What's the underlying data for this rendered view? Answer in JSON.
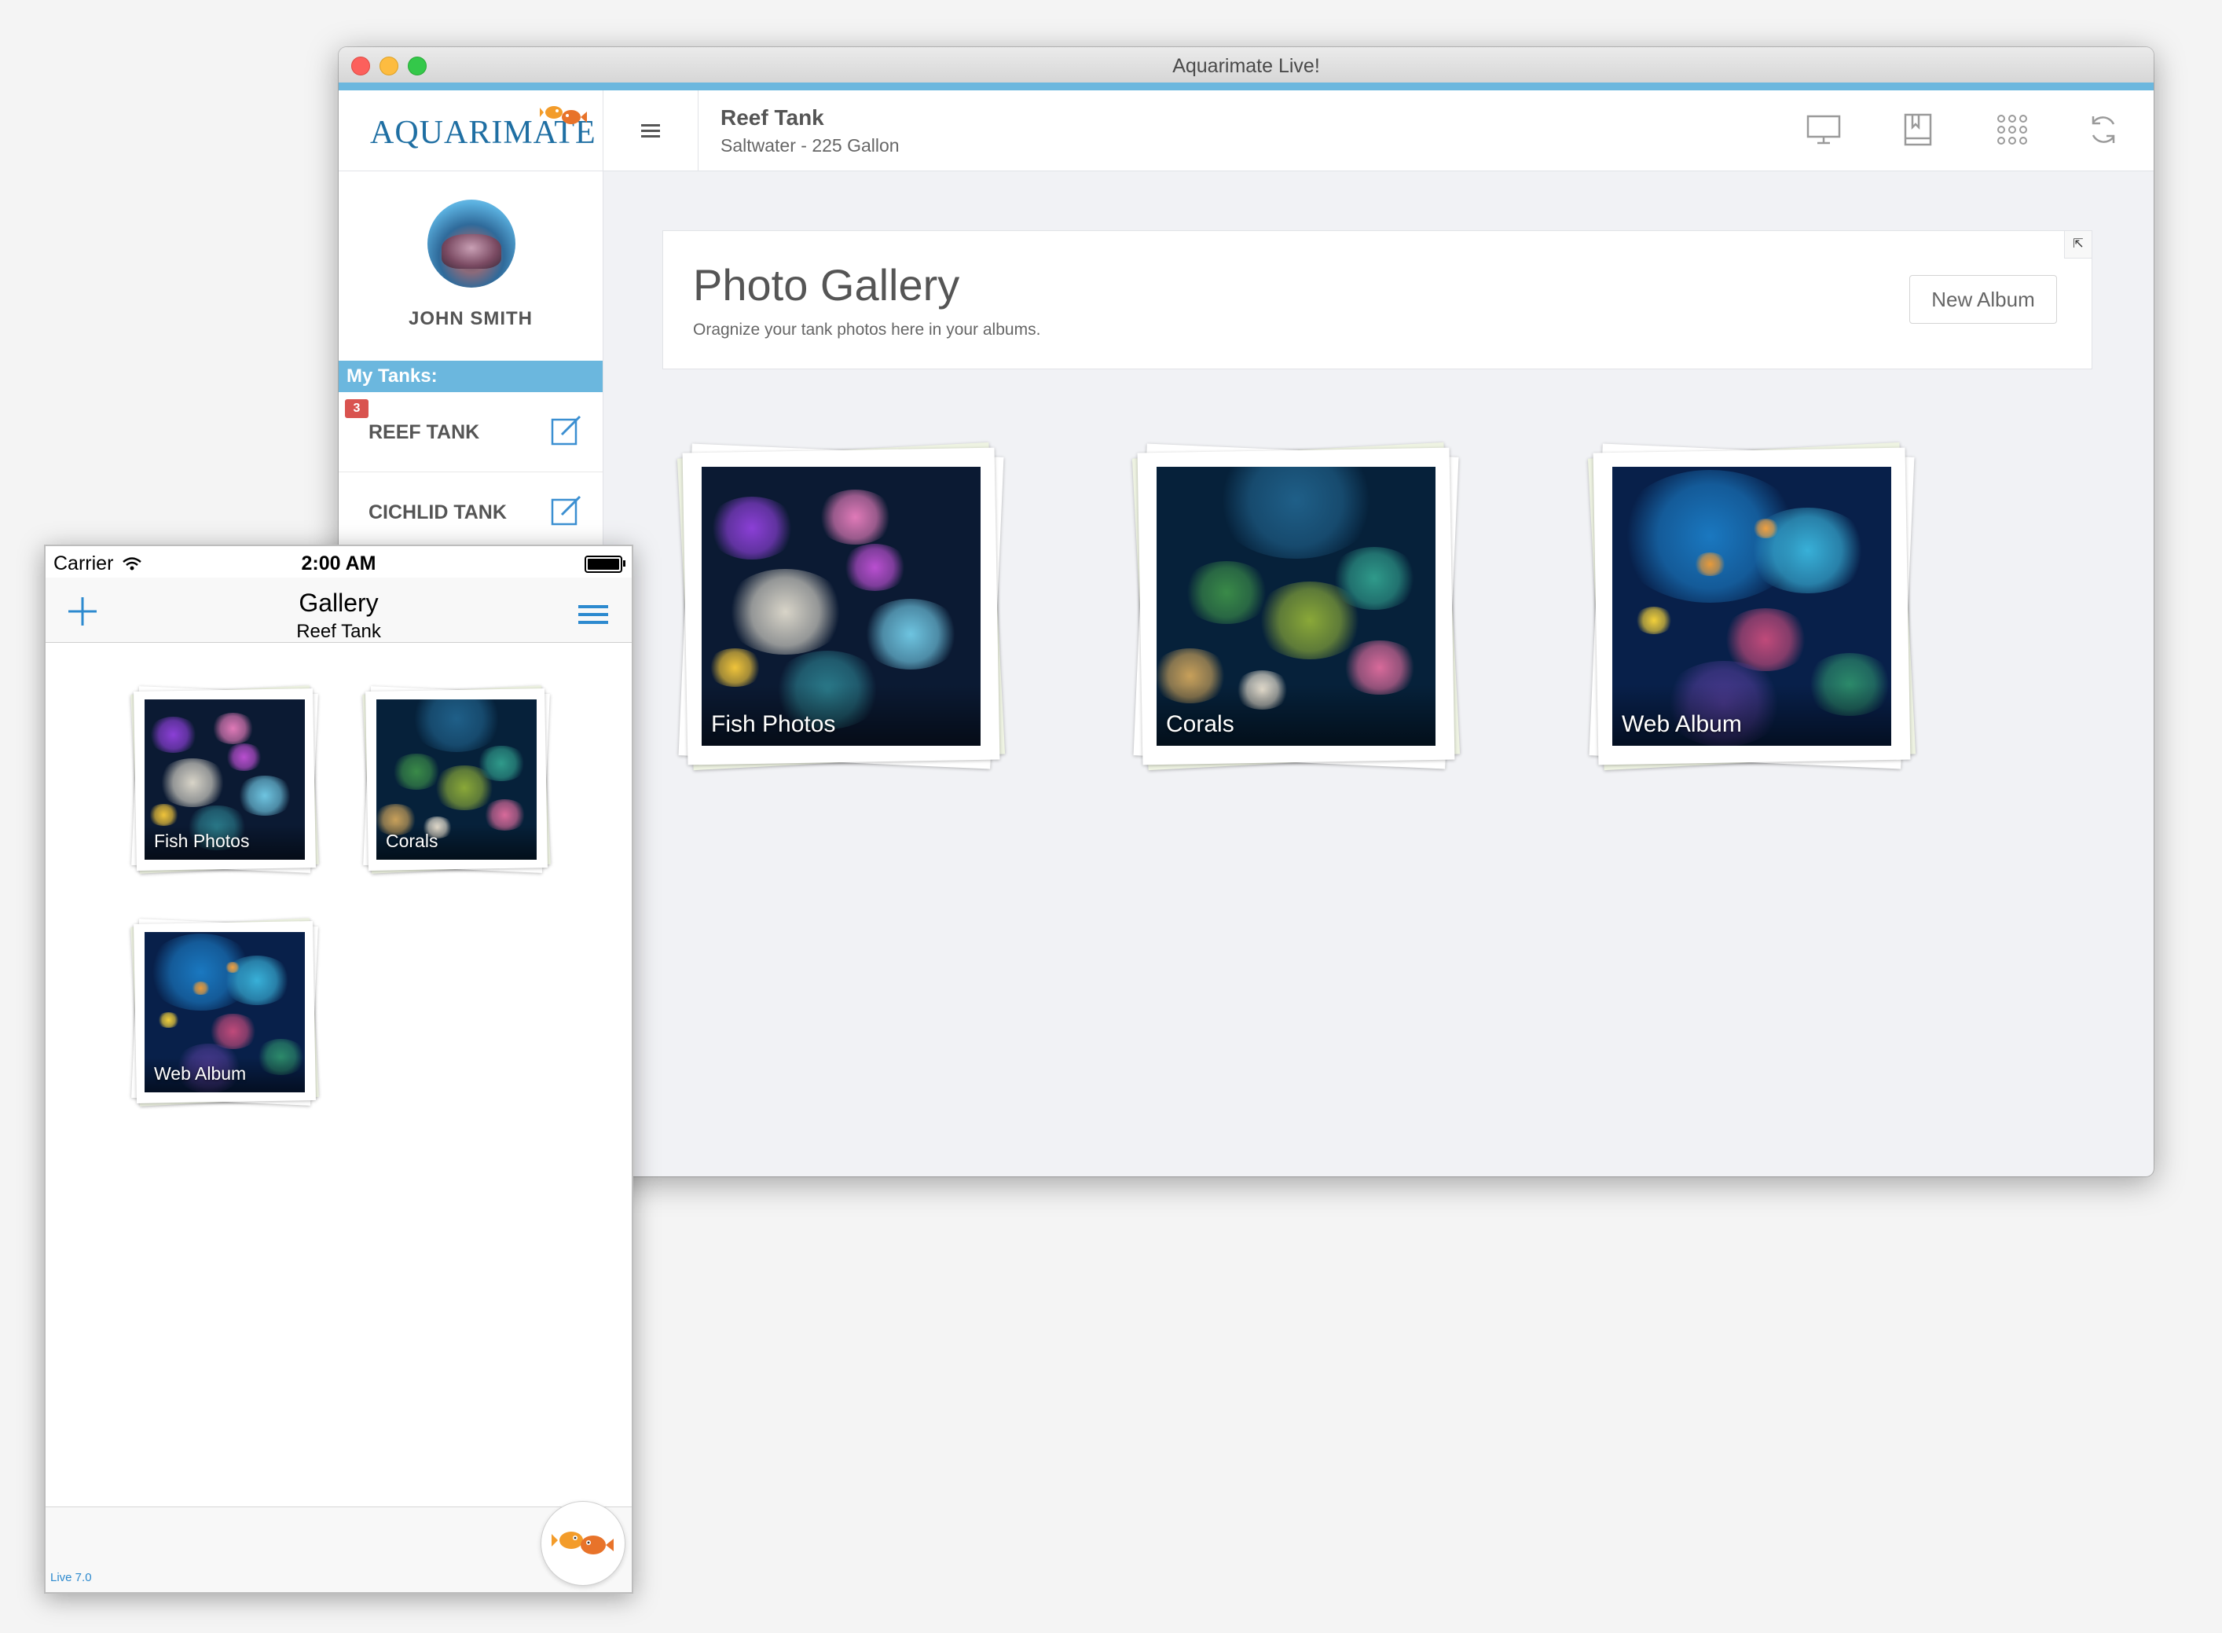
{
  "window": {
    "title": "Aquarimate Live!"
  },
  "header": {
    "logo_text": "AQUARIMATE",
    "tank_title": "Reef Tank",
    "tank_subtitle": "Saltwater - 225 Gallon",
    "icons": [
      "monitor-icon",
      "book-icon",
      "grid-dots-icon",
      "refresh-icon"
    ]
  },
  "sidebar": {
    "user_name": "JOHN SMITH",
    "section_label": "My Tanks:",
    "tanks": [
      {
        "name": "REEF TANK",
        "badge": "3"
      },
      {
        "name": "CICHLID TANK",
        "badge": ""
      }
    ]
  },
  "gallery": {
    "title": "Photo Gallery",
    "subtitle": "Oragnize your tank photos here in your albums.",
    "new_album_label": "New Album",
    "expand_glyph": "⇱",
    "albums": [
      {
        "name": "Fish Photos"
      },
      {
        "name": "Corals"
      },
      {
        "name": "Web Album"
      }
    ]
  },
  "phone": {
    "carrier": "Carrier",
    "time": "2:00 AM",
    "nav_title": "Gallery",
    "nav_subtitle": "Reef Tank",
    "albums": [
      {
        "name": "Fish Photos"
      },
      {
        "name": "Corals"
      },
      {
        "name": "Web Album"
      }
    ],
    "version": "Live 7.0"
  },
  "colors": {
    "accent": "#6bb7de",
    "brand_blue": "#1f6fa3",
    "badge": "#d9534f",
    "fish_orange": "#f39c2a"
  }
}
